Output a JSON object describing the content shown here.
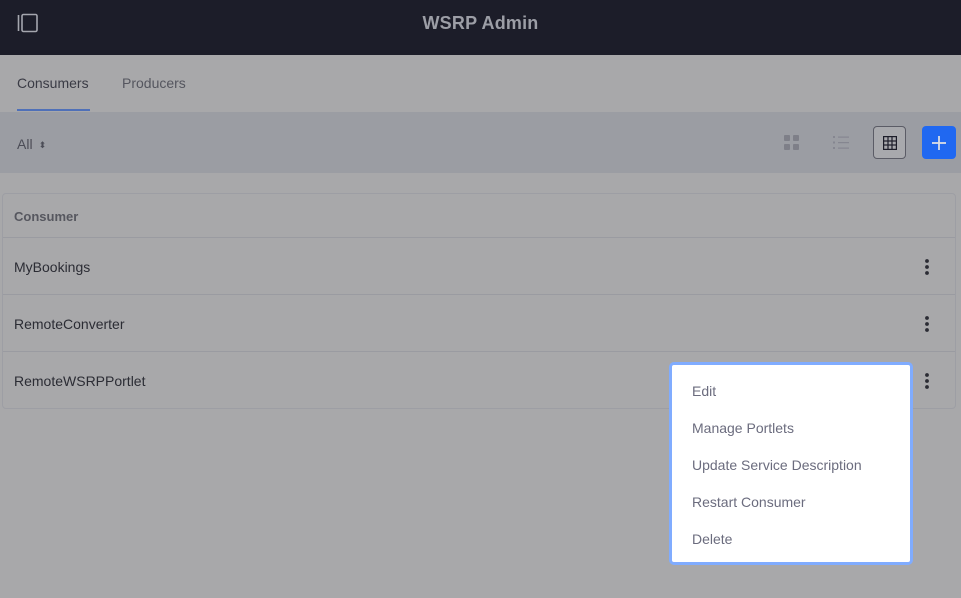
{
  "header": {
    "title": "WSRP Admin",
    "sidebar_toggle_icon": "sidebar-toggle-icon"
  },
  "tabs": [
    {
      "label": "Consumers",
      "active": true
    },
    {
      "label": "Producers",
      "active": false
    }
  ],
  "toolbar": {
    "filter_label": "All",
    "filter_caret": "⬍",
    "view_modes": [
      "cards-icon",
      "list-icon",
      "table-icon"
    ],
    "active_view": "table-icon",
    "add_icon": "plus-icon"
  },
  "table": {
    "header": "Consumer",
    "rows": [
      {
        "name": "MyBookings"
      },
      {
        "name": "RemoteConverter"
      },
      {
        "name": "RemoteWSRPPortlet"
      }
    ]
  },
  "context_menu": {
    "items": [
      "Edit",
      "Manage Portlets",
      "Update Service Description",
      "Restart Consumer",
      "Delete"
    ]
  },
  "colors": {
    "topbar": "#1c1d29",
    "accent": "#0b5fff",
    "menu_border": "#80acff"
  }
}
